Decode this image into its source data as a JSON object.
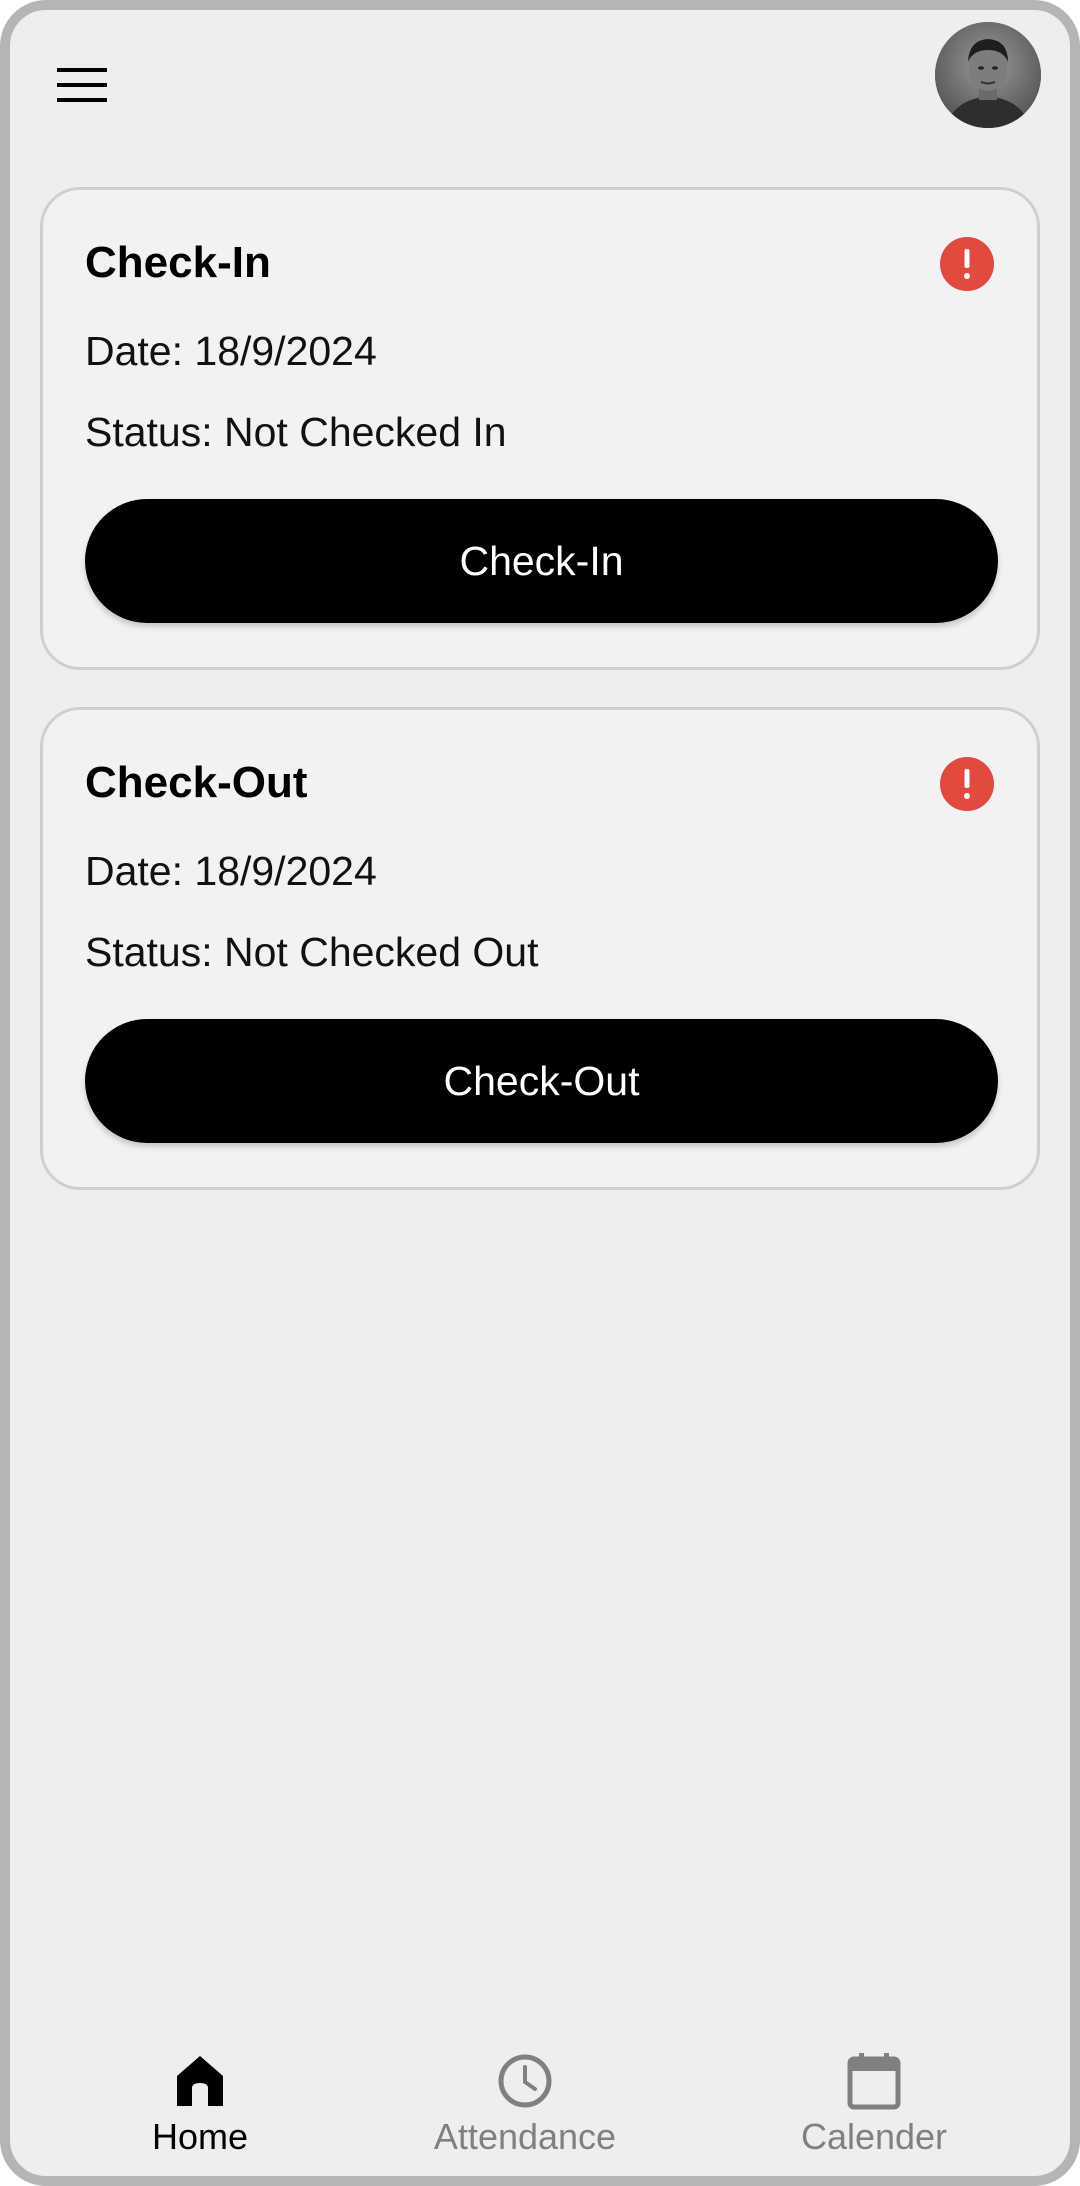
{
  "header": {
    "menu_icon": "hamburger-menu-icon",
    "avatar": "user-avatar-photo"
  },
  "cards": [
    {
      "title": "Check-In",
      "date": "Date: 18/9/2024",
      "status": "Status: Not Checked In",
      "button_label": "Check-In",
      "status_icon": "alert-circle-icon"
    },
    {
      "title": "Check-Out",
      "date": "Date: 18/9/2024",
      "status": "Status: Not Checked Out",
      "button_label": "Check-Out",
      "status_icon": "alert-circle-icon"
    }
  ],
  "bottom_nav": {
    "items": [
      {
        "label": "Home",
        "icon": "home-icon",
        "active": true
      },
      {
        "label": "Attendance",
        "icon": "clock-icon",
        "active": false
      },
      {
        "label": "Calender",
        "icon": "calendar-icon",
        "active": false
      }
    ]
  },
  "colors": {
    "background": "#eeeeee",
    "card_background": "#f2f2f2",
    "alert": "#e14a3c",
    "button": "#000000",
    "nav_active": "#000000",
    "nav_inactive": "#808080"
  }
}
